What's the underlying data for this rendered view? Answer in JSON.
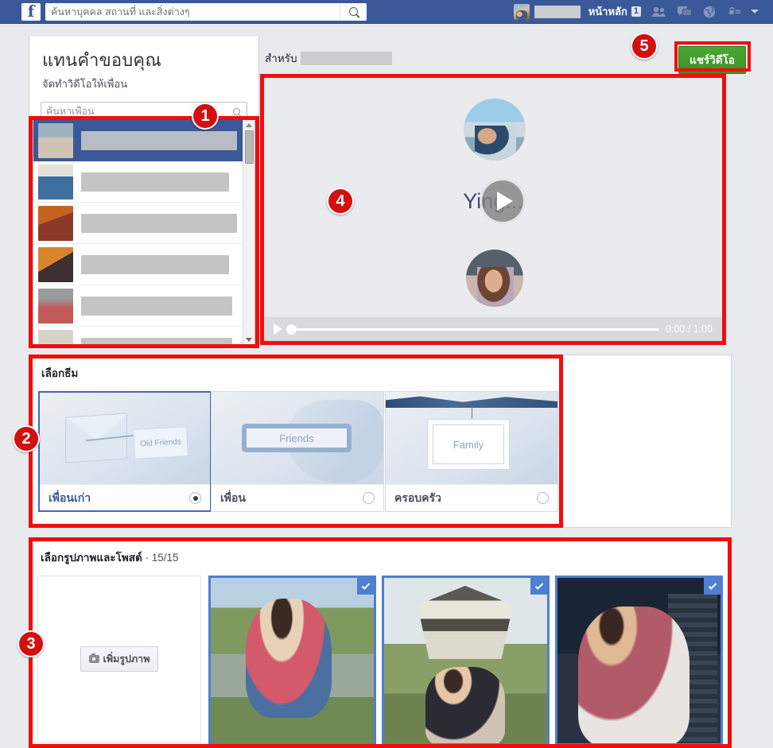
{
  "header": {
    "logo": "f",
    "search": {
      "placeholder": "ค้นหาบุคคล สถานที่ และสิ่งต่างๆ",
      "value": "",
      "icon": "search-icon"
    },
    "home_label": "หน้าหลัก",
    "home_count": "1",
    "nav_icons": [
      "friend-requests-icon",
      "messages-icon",
      "notifications-globe-icon",
      "privacy-lock-icon",
      "account-caret-icon"
    ],
    "brand_color": "#3b5998"
  },
  "left_panel": {
    "title": "แทนคำขอบคุณ",
    "subtitle": "จัดทำวิดีโอให้เพื่อน",
    "friend_search_placeholder": "ค้นหาเพื่อน",
    "friend_search_value": "",
    "friends": [
      {
        "name": "",
        "selected": true
      },
      {
        "name": "",
        "selected": false
      },
      {
        "name": "",
        "selected": false
      },
      {
        "name": "",
        "selected": false
      },
      {
        "name": "",
        "selected": false
      },
      {
        "name": "",
        "selected": false
      }
    ]
  },
  "video": {
    "for_label": "สำหรับ",
    "for_name": "",
    "share_button": "แชร์วิดีโอ",
    "share_button_color": "#42a128",
    "title_text": "Ying...",
    "time_display": "0:00 / 1:00",
    "progress_percent": 0,
    "play_icon": "play-icon"
  },
  "themes": {
    "section_title": "เลือกธีม",
    "items": [
      {
        "label": "เพื่อนเก่า",
        "art_text": "Old Friends",
        "selected": true
      },
      {
        "label": "เพื่อน",
        "art_text": "Friends",
        "selected": false
      },
      {
        "label": "ครอบครัว",
        "art_text": "Family",
        "selected": false
      }
    ]
  },
  "photos": {
    "section_title": "เลือกรูปภาพและโพสต์",
    "separator": "·",
    "count": "15/15",
    "add_button": "เพิ่มรูปภาพ",
    "add_icon": "camera-icon",
    "tiles": [
      {
        "selected": true,
        "check_icon": "check-icon"
      },
      {
        "selected": true,
        "check_icon": "check-icon"
      },
      {
        "selected": true,
        "check_icon": "check-icon"
      }
    ]
  },
  "annotations": {
    "markers": [
      {
        "number": "1",
        "target": "friend-list"
      },
      {
        "number": "2",
        "target": "theme-section"
      },
      {
        "number": "3",
        "target": "photo-section"
      },
      {
        "number": "4",
        "target": "video-preview"
      },
      {
        "number": "5",
        "target": "share-button"
      }
    ],
    "highlight_color": "#f20d0d"
  }
}
